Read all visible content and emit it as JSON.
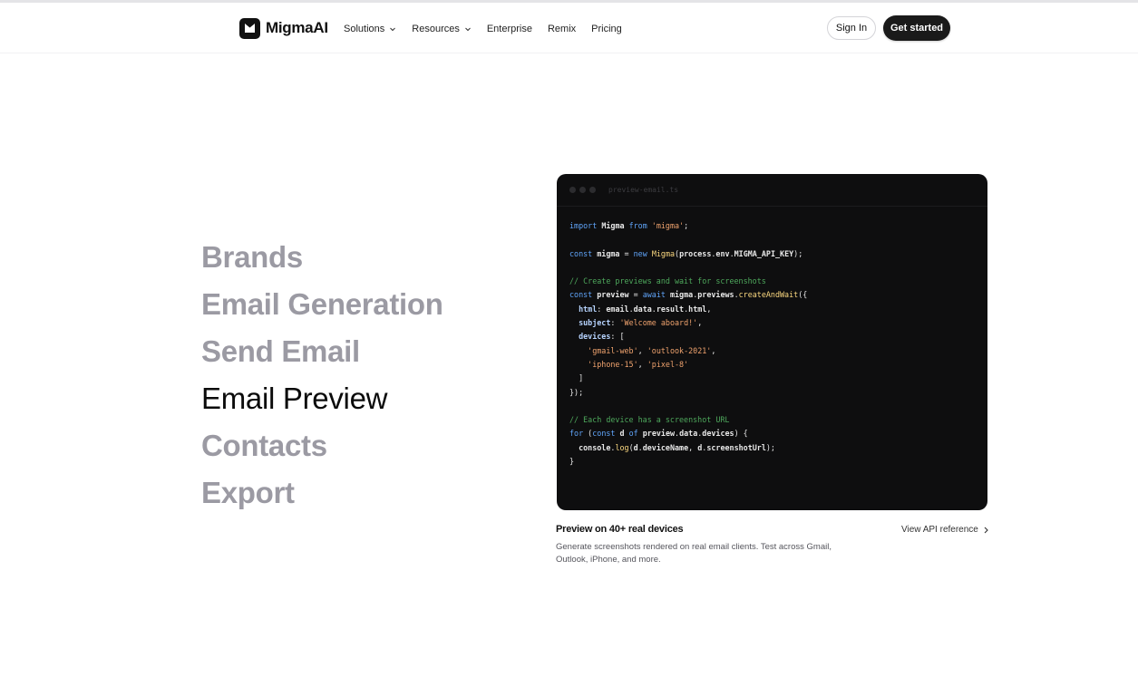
{
  "header": {
    "brand": "MigmaAI",
    "nav": [
      {
        "label": "Solutions",
        "has_dropdown": true
      },
      {
        "label": "Resources",
        "has_dropdown": true
      },
      {
        "label": "Enterprise",
        "has_dropdown": false
      },
      {
        "label": "Remix",
        "has_dropdown": false
      },
      {
        "label": "Pricing",
        "has_dropdown": false
      }
    ],
    "sign_in": "Sign In",
    "get_started": "Get started"
  },
  "features": {
    "items": [
      "Brands",
      "Email Generation",
      "Send Email",
      "Email Preview",
      "Contacts",
      "Export"
    ],
    "active": "Email Preview"
  },
  "code": {
    "filename": "preview-email.ts",
    "lines": [
      "import Migma from 'migma';",
      "",
      "const migma = new Migma(process.env.MIGMA_API_KEY);",
      "",
      "// Create previews and wait for screenshots",
      "const preview = await migma.previews.createAndWait({",
      "  html: email.data.result.html,",
      "  subject: 'Welcome aboard!',",
      "  devices: [",
      "    'gmail-web', 'outlook-2021',",
      "    'iphone-15', 'pixel-8'",
      "  ]",
      "});",
      "",
      "// Each device has a screenshot URL",
      "for (const d of preview.data.devices) {",
      "  console.log(d.deviceName, d.screenshotUrl);",
      "}"
    ]
  },
  "caption": {
    "title": "Preview on 40+ real devices",
    "description": "Generate screenshots rendered on real email clients. Test across Gmail, Outlook, iPhone, and more.",
    "link": "View API reference"
  },
  "colors": {
    "active_text": "#0b0b0b",
    "inactive_text": "#9b9aa3",
    "code_bg": "#0e0e0f",
    "keyword": "#60a5fa",
    "string": "#f0a36e",
    "comment": "#4ea85c",
    "button_dark": "#1a1a1a"
  }
}
